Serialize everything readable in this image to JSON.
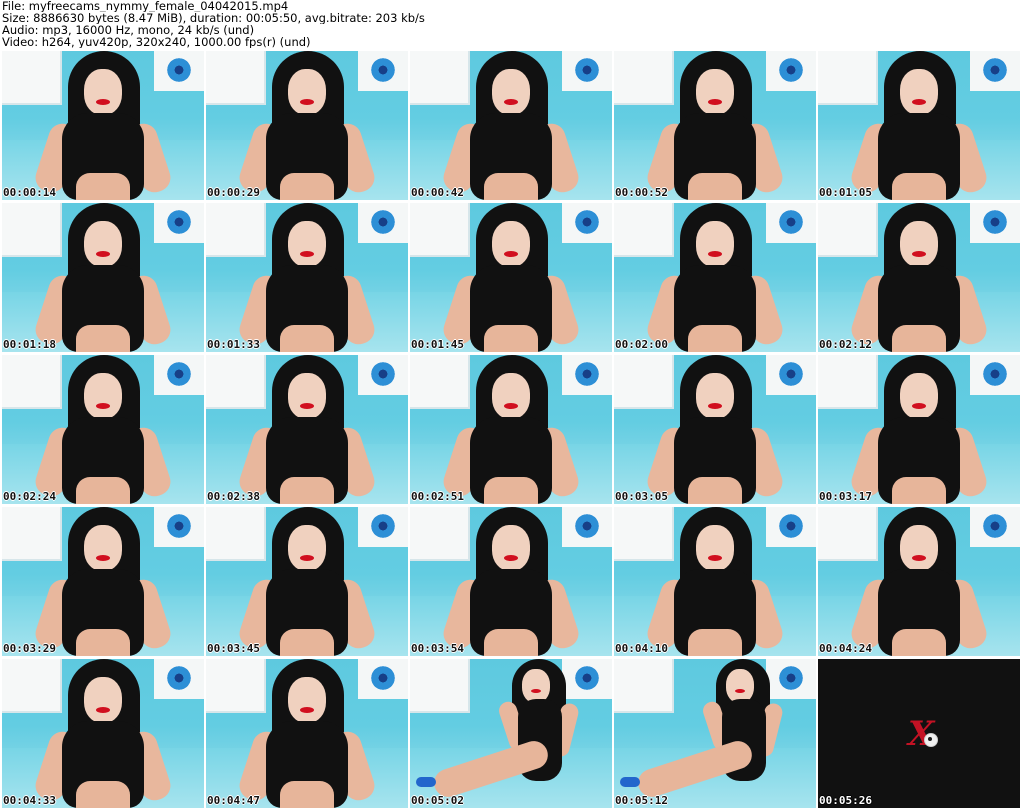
{
  "header": {
    "file": "File: myfreecams_nymmy_female_04042015.mp4",
    "size": "Size: 8886630 bytes (8.47 MiB), duration: 00:05:50, avg.bitrate: 203 kb/s",
    "audio": "Audio: mp3, 16000 Hz, mono, 24 kb/s (und)",
    "video": "Video: h264, yuv420p, 320x240, 1000.00 fps(r) (und)"
  },
  "thumbnails": [
    {
      "timestamp": "00:00:14",
      "pose": "standard"
    },
    {
      "timestamp": "00:00:29",
      "pose": "standard"
    },
    {
      "timestamp": "00:00:42",
      "pose": "standard"
    },
    {
      "timestamp": "00:00:52",
      "pose": "standard"
    },
    {
      "timestamp": "00:01:05",
      "pose": "standard"
    },
    {
      "timestamp": "00:01:18",
      "pose": "standard"
    },
    {
      "timestamp": "00:01:33",
      "pose": "standard"
    },
    {
      "timestamp": "00:01:45",
      "pose": "standard"
    },
    {
      "timestamp": "00:02:00",
      "pose": "standard"
    },
    {
      "timestamp": "00:02:12",
      "pose": "standard"
    },
    {
      "timestamp": "00:02:24",
      "pose": "standard"
    },
    {
      "timestamp": "00:02:38",
      "pose": "standard"
    },
    {
      "timestamp": "00:02:51",
      "pose": "standard"
    },
    {
      "timestamp": "00:03:05",
      "pose": "standard"
    },
    {
      "timestamp": "00:03:17",
      "pose": "standard"
    },
    {
      "timestamp": "00:03:29",
      "pose": "standard"
    },
    {
      "timestamp": "00:03:45",
      "pose": "standard"
    },
    {
      "timestamp": "00:03:54",
      "pose": "standard"
    },
    {
      "timestamp": "00:04:10",
      "pose": "standard"
    },
    {
      "timestamp": "00:04:24",
      "pose": "standard"
    },
    {
      "timestamp": "00:04:33",
      "pose": "standard"
    },
    {
      "timestamp": "00:04:47",
      "pose": "standard"
    },
    {
      "timestamp": "00:05:02",
      "pose": "wide"
    },
    {
      "timestamp": "00:05:12",
      "pose": "wide"
    },
    {
      "timestamp": "00:05:26",
      "pose": "logo"
    }
  ]
}
